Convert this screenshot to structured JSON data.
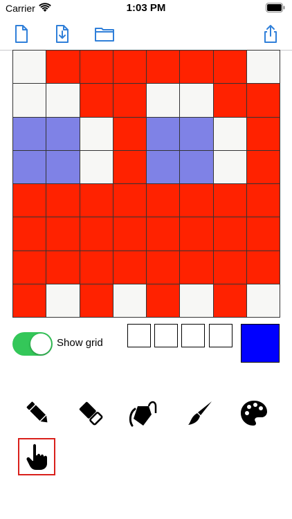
{
  "status_bar": {
    "carrier": "Carrier",
    "time": "1:03 PM"
  },
  "toolbar": {
    "icons": [
      "new-document-icon",
      "save-document-icon",
      "open-folder-icon",
      "share-icon"
    ]
  },
  "colors": {
    "R": "#ff2200",
    "W": "#f7f7f5",
    "B": "#7f82e6",
    "accent": "#2f7fd9",
    "toggle_on": "#34c759",
    "current_color": "#0000ff",
    "tool_selected": "#d9201b"
  },
  "canvas": {
    "rows": [
      "WRRRRRRW",
      "WWRRWWRR",
      "BBWRBBWR",
      "BBWRBBWR",
      "RRRRRRRR",
      "RRRRRRRR",
      "RRRRRRRR",
      "RWRWRWRW"
    ]
  },
  "controls": {
    "show_grid_label": "Show grid",
    "show_grid_on": true,
    "recent_swatches": [
      "#ffffff",
      "#ffffff",
      "#ffffff",
      "#ffffff"
    ],
    "current_color": "#0000ff"
  },
  "tools": [
    {
      "name": "pencil-icon",
      "selected": false
    },
    {
      "name": "eraser-icon",
      "selected": false
    },
    {
      "name": "paint-bucket-icon",
      "selected": false
    },
    {
      "name": "brush-icon",
      "selected": false
    },
    {
      "name": "palette-icon",
      "selected": false
    },
    {
      "name": "hand-pointer-icon",
      "selected": true
    }
  ]
}
